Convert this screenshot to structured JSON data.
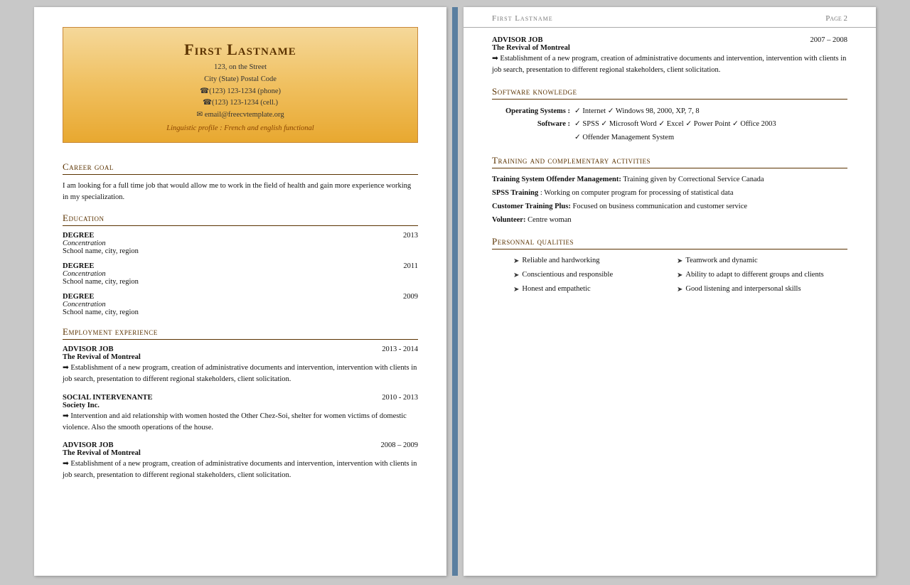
{
  "page1": {
    "header": {
      "name": "First Lastname",
      "address": "123, on the Street",
      "city": "City (State) Postal Code",
      "phone1": "☎(123) 123-1234 (phone)",
      "phone2": "☎(123) 123-1234 (cell.)",
      "email": "✉ email@freecvtemplate.org",
      "linguistic": "Linguistic profile : French and english functional"
    },
    "career_goal": {
      "title": "Career goal",
      "text": "I am looking for a full time job that would allow me to work in the field of health and gain more experience working in my specialization."
    },
    "education": {
      "title": "Education",
      "entries": [
        {
          "degree": "DEGREE",
          "year": "2013",
          "concentration": "Concentration",
          "school": "School name, city, region"
        },
        {
          "degree": "DEGREE",
          "year": "2011",
          "concentration": "Concentration",
          "school": "School name, city, region"
        },
        {
          "degree": "DEGREE",
          "year": "2009",
          "concentration": "Concentration",
          "school": "School name, city, region"
        }
      ]
    },
    "employment": {
      "title": "Employment experience",
      "entries": [
        {
          "job": "ADVISOR JOB",
          "years": "2013 - 2014",
          "company": "The Revival of Montreal",
          "desc": "➡ Establishment of a new program, creation of administrative documents and intervention, intervention with clients in job search, presentation to different regional stakeholders, client solicitation."
        },
        {
          "job": "SOCIAL INTERVENANTE",
          "years": "2010 - 2013",
          "company": "Society Inc.",
          "desc": "➡ Intervention and aid relationship with women hosted the Other Chez-Soi, shelter for women victims of domestic violence. Also the smooth operations of the house."
        },
        {
          "job": "ADVISOR JOB",
          "years": "2008 – 2009",
          "company": "The Revival of Montreal",
          "desc": "➡ Establishment of a new program, creation of administrative documents and intervention, intervention with clients in job search, presentation to different regional stakeholders, client solicitation."
        }
      ]
    }
  },
  "page2": {
    "header": {
      "name": "First Lastname",
      "page": "Page 2"
    },
    "prev_job": {
      "job": "ADVISOR JOB",
      "years": "2007 – 2008",
      "company": "The Revival of Montreal",
      "desc": "➡ Establishment of a new program, creation of administrative documents and intervention, intervention with clients in job search, presentation to different regional stakeholders, client solicitation."
    },
    "software": {
      "title": "Software knowledge",
      "rows": [
        {
          "label": "Operating Systems :",
          "value": "✓ Internet ✓ Windows 98, 2000, XP, 7, 8"
        },
        {
          "label": "Software :",
          "value": "✓ SPSS ✓ Microsoft Word ✓ Excel ✓ Power Point ✓ Office 2003"
        },
        {
          "label": "",
          "value": "✓ Offender Management System"
        }
      ]
    },
    "training": {
      "title": "Training and complementary activities",
      "entries": [
        {
          "label": "Training System Offender Management:",
          "text": " Training given by Correctional Service Canada"
        },
        {
          "label": "SPSS Training",
          "text": ": Working on computer program for processing of statistical data"
        },
        {
          "label": "Customer Training Plus:",
          "text": " Focused on business communication and customer service"
        },
        {
          "label": "Volunteer:",
          "text": " Centre woman"
        }
      ]
    },
    "qualities": {
      "title": "Personnal qualities",
      "items_col1": [
        "Reliable and hardworking",
        "Conscientious and responsible",
        "Honest and empathetic"
      ],
      "items_col2": [
        "Teamwork and dynamic",
        "Ability to adapt to different groups and clients",
        "Good listening and interpersonal skills"
      ]
    }
  }
}
